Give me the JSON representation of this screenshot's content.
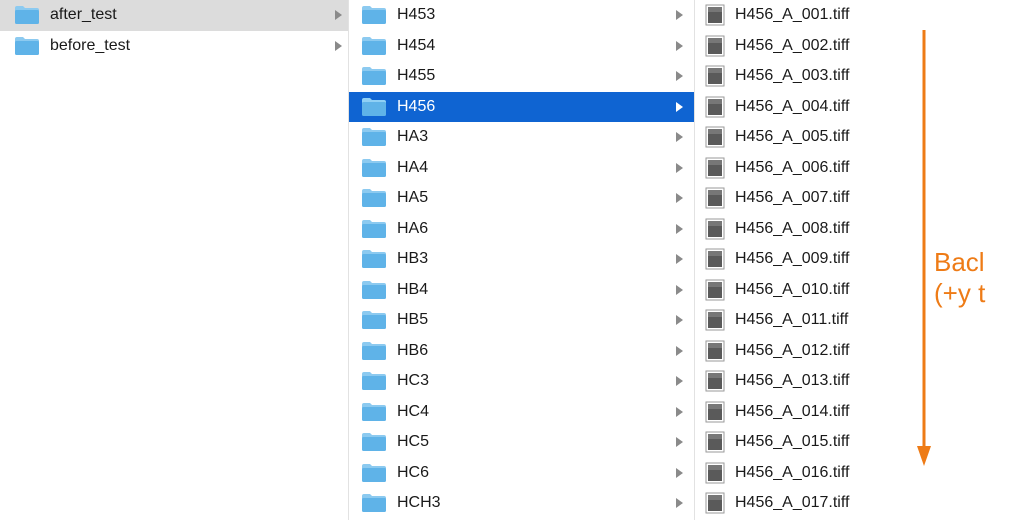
{
  "column1": {
    "items": [
      {
        "label": "after_test",
        "state": "selected-inactive"
      },
      {
        "label": "before_test",
        "state": ""
      }
    ]
  },
  "column2": {
    "items": [
      {
        "label": "H453",
        "state": ""
      },
      {
        "label": "H454",
        "state": ""
      },
      {
        "label": "H455",
        "state": ""
      },
      {
        "label": "H456",
        "state": "selected-active"
      },
      {
        "label": "HA3",
        "state": ""
      },
      {
        "label": "HA4",
        "state": ""
      },
      {
        "label": "HA5",
        "state": ""
      },
      {
        "label": "HA6",
        "state": ""
      },
      {
        "label": "HB3",
        "state": ""
      },
      {
        "label": "HB4",
        "state": ""
      },
      {
        "label": "HB5",
        "state": ""
      },
      {
        "label": "HB6",
        "state": ""
      },
      {
        "label": "HC3",
        "state": ""
      },
      {
        "label": "HC4",
        "state": ""
      },
      {
        "label": "HC5",
        "state": ""
      },
      {
        "label": "HC6",
        "state": ""
      },
      {
        "label": "HCH3",
        "state": ""
      }
    ]
  },
  "column3": {
    "items": [
      "H456_A_001.tiff",
      "H456_A_002.tiff",
      "H456_A_003.tiff",
      "H456_A_004.tiff",
      "H456_A_005.tiff",
      "H456_A_006.tiff",
      "H456_A_007.tiff",
      "H456_A_008.tiff",
      "H456_A_009.tiff",
      "H456_A_010.tiff",
      "H456_A_011.tiff",
      "H456_A_012.tiff",
      "H456_A_013.tiff",
      "H456_A_014.tiff",
      "H456_A_015.tiff",
      "H456_A_016.tiff",
      "H456_A_017.tiff"
    ]
  },
  "annotation": {
    "text_line1": "Bacl",
    "text_line2": "(+y t",
    "color": "#ee7b16"
  },
  "colors": {
    "folder_blue": "#5fb3e8",
    "selected_blue": "#0f64d2",
    "selected_gray": "#dcdcdc"
  },
  "icons": {
    "folder": "folder-icon",
    "file": "tiff-file-icon",
    "chevron": "chevron-right-icon"
  }
}
